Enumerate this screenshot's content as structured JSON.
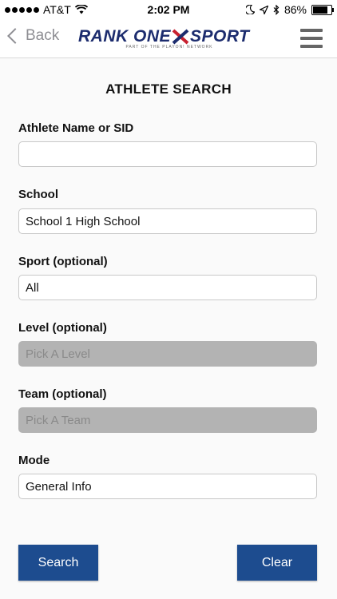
{
  "status_bar": {
    "carrier": "AT&T",
    "time": "2:02 PM",
    "battery_percent": "86%",
    "icons": [
      "signal-dots",
      "wifi-icon",
      "moon-icon",
      "location-arrow-icon",
      "bluetooth-icon",
      "battery-icon"
    ]
  },
  "navbar": {
    "back_label": "Back",
    "logo_text": "RANK ONE",
    "logo_text_2": "SPORT",
    "logo_tagline": "PART OF THE PLAYON! NETWORK"
  },
  "page": {
    "title": "ATHLETE SEARCH"
  },
  "form": {
    "athlete": {
      "label": "Athlete Name or SID",
      "value": "",
      "placeholder": ""
    },
    "school": {
      "label": "School",
      "value": "School 1 High School"
    },
    "sport": {
      "label": "Sport (optional)",
      "value": "All"
    },
    "level": {
      "label": "Level (optional)",
      "value": "Pick A Level",
      "disabled": true
    },
    "team": {
      "label": "Team (optional)",
      "value": "Pick A Team",
      "disabled": true
    },
    "mode": {
      "label": "Mode",
      "value": "General Info"
    }
  },
  "buttons": {
    "search_label": "Search",
    "clear_label": "Clear"
  },
  "colors": {
    "button_bg": "#1d4c8f",
    "disabled_field": "#b3b3b3",
    "logo_navy": "#1c2c6e",
    "logo_red": "#c7202f"
  }
}
